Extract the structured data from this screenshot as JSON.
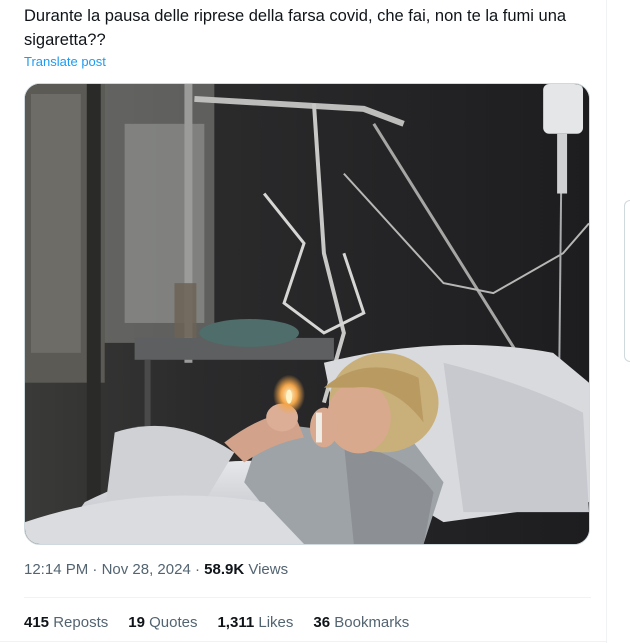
{
  "post": {
    "text": "Durante la pausa delle riprese della farsa covid, che fai, non te la fumi una sigaretta??",
    "translate_label": "Translate post",
    "time": "12:14 PM",
    "separator": "·",
    "date": "Nov 28, 2024",
    "views_count": "58.9K",
    "views_label": "Views"
  },
  "stats": {
    "reposts": {
      "count": "415",
      "label": "Reposts"
    },
    "quotes": {
      "count": "19",
      "label": "Quotes"
    },
    "likes": {
      "count": "1,311",
      "label": "Likes"
    },
    "bookmarks": {
      "count": "36",
      "label": "Bookmarks"
    }
  },
  "colors": {
    "link": "#1d9bf0",
    "text": "#0f1419",
    "secondary": "#536471",
    "border": "#cfd9de"
  },
  "media": {
    "icon": "photo-hospital-bed-icon"
  }
}
